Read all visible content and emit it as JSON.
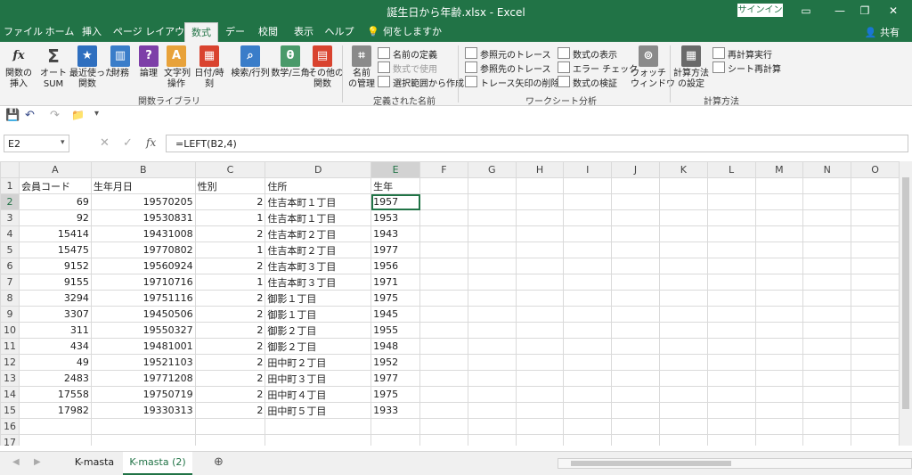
{
  "title": "誕生日から年齢.xlsx  -  Excel",
  "signin": "サインイン",
  "share": "共有",
  "tabs": [
    "ファイル",
    "ホーム",
    "挿入",
    "ページ レイアウト",
    "数式",
    "データ",
    "校閲",
    "表示",
    "ヘルプ"
  ],
  "tell_me": "何をしますか",
  "ribbon": {
    "insert_fn": "関数の\n挿入",
    "autosum": "オート\nSUM",
    "recent": "最近使った\n関数",
    "finance": "財務",
    "logic": "論理",
    "text": "文字列\n操作",
    "datetime": "日付/時刻",
    "lookup": "検索/行列",
    "math": "数学/三角",
    "more": "その他の\n関数",
    "group_lib": "関数ライブラリ",
    "name_mgr": "名前\nの管理",
    "define_name": "名前の定義",
    "use_in_formula": "数式で使用",
    "create_from_sel": "選択範囲から作成",
    "group_names": "定義された名前",
    "trace_prec": "参照元のトレース",
    "trace_dep": "参照先のトレース",
    "remove_arrows": "トレース矢印の削除",
    "show_formulas": "数式の表示",
    "error_check": "エラー チェック",
    "eval_formula": "数式の検証",
    "watch": "ウォッチ\nウィンドウ",
    "group_audit": "ワークシート分析",
    "calc_options": "計算方法\nの設定",
    "calc_now": "再計算実行",
    "calc_sheet": "シート再計算",
    "group_calc": "計算方法"
  },
  "namebox": "E2",
  "formula": "=LEFT(B2,4)",
  "columns": [
    "A",
    "B",
    "C",
    "D",
    "E",
    "F",
    "G",
    "H",
    "I",
    "J",
    "K",
    "L",
    "M",
    "N",
    "O"
  ],
  "rows": [
    [
      "会員コード",
      "生年月日",
      "性別",
      "住所",
      "生年"
    ],
    [
      "69",
      "19570205",
      "2",
      "住吉本町１丁目",
      "1957"
    ],
    [
      "92",
      "19530831",
      "1",
      "住吉本町１丁目",
      "1953"
    ],
    [
      "15414",
      "19431008",
      "2",
      "住吉本町２丁目",
      "1943"
    ],
    [
      "15475",
      "19770802",
      "1",
      "住吉本町２丁目",
      "1977"
    ],
    [
      "9152",
      "19560924",
      "2",
      "住吉本町３丁目",
      "1956"
    ],
    [
      "9155",
      "19710716",
      "1",
      "住吉本町３丁目",
      "1971"
    ],
    [
      "3294",
      "19751116",
      "2",
      "御影１丁目",
      "1975"
    ],
    [
      "3307",
      "19450506",
      "2",
      "御影１丁目",
      "1945"
    ],
    [
      "311",
      "19550327",
      "2",
      "御影２丁目",
      "1955"
    ],
    [
      "434",
      "19481001",
      "2",
      "御影２丁目",
      "1948"
    ],
    [
      "49",
      "19521103",
      "2",
      "田中町２丁目",
      "1952"
    ],
    [
      "2483",
      "19771208",
      "2",
      "田中町３丁目",
      "1977"
    ],
    [
      "17558",
      "19750719",
      "2",
      "田中町４丁目",
      "1975"
    ],
    [
      "17982",
      "19330313",
      "2",
      "田中町５丁目",
      "1933"
    ],
    [
      "",
      "",
      "",
      "",
      ""
    ],
    [
      "",
      "",
      "",
      "",
      ""
    ]
  ],
  "sheets": [
    "K-masta",
    "K-masta (2)"
  ],
  "accent": "#217346"
}
